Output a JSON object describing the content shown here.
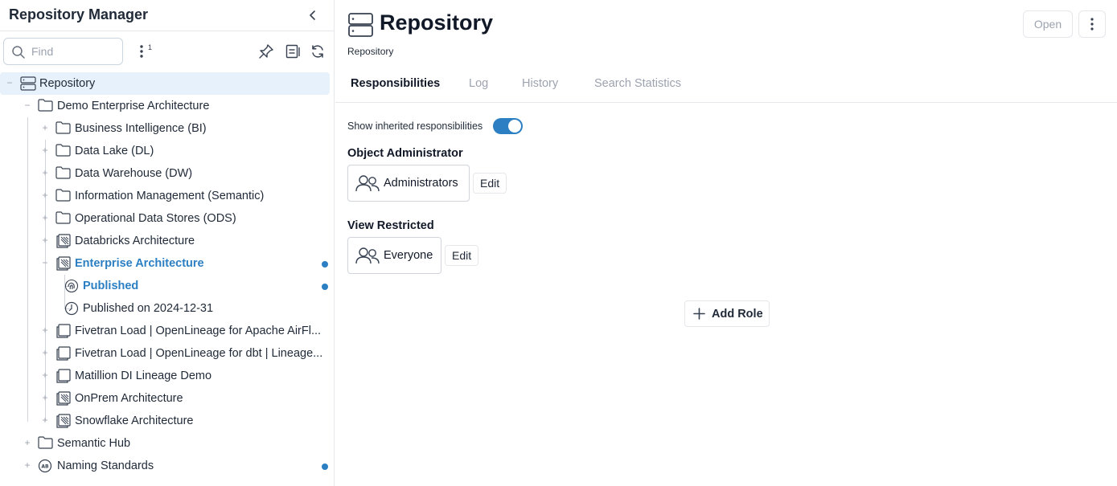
{
  "sidebar": {
    "title": "Repository Manager",
    "search_placeholder": "Find",
    "filter_badge": "1",
    "tree": [
      {
        "label": "Repository",
        "icon": "server-icon",
        "expander": "−",
        "selected": true
      },
      {
        "label": "Demo Enterprise Architecture",
        "icon": "folder-icon",
        "expander": "−"
      },
      {
        "label": "Business Intelligence (BI)",
        "icon": "folder-icon",
        "expander": "+"
      },
      {
        "label": "Data Lake (DL)",
        "icon": "folder-icon",
        "expander": "+"
      },
      {
        "label": "Data Warehouse (DW)",
        "icon": "folder-icon",
        "expander": "+"
      },
      {
        "label": "Information Management (Semantic)",
        "icon": "folder-icon",
        "expander": "+"
      },
      {
        "label": "Operational Data Stores (ODS)",
        "icon": "folder-icon",
        "expander": "+"
      },
      {
        "label": "Databricks Architecture",
        "icon": "stacked-model-icon",
        "expander": "+"
      },
      {
        "label": "Enterprise Architecture",
        "icon": "stacked-model-icon",
        "expander": "−",
        "active": true,
        "dot": true
      },
      {
        "label": "Published",
        "icon": "fingerprint-icon",
        "active": true,
        "dot": true
      },
      {
        "label": "Published on 2024-12-31",
        "icon": "clock-icon"
      },
      {
        "label": "Fivetran Load | OpenLineage for Apache AirFl...",
        "icon": "model-copy-icon",
        "expander": "+"
      },
      {
        "label": "Fivetran Load | OpenLineage for dbt | Lineage...",
        "icon": "model-copy-icon",
        "expander": "+"
      },
      {
        "label": "Matillion DI Lineage Demo",
        "icon": "model-copy-icon",
        "expander": "+"
      },
      {
        "label": "OnPrem Architecture",
        "icon": "stacked-model-icon",
        "expander": "+"
      },
      {
        "label": "Snowflake Architecture",
        "icon": "stacked-model-icon",
        "expander": "+"
      },
      {
        "label": "Semantic Hub",
        "icon": "folder-icon",
        "expander": "+"
      },
      {
        "label": "Naming Standards",
        "icon": "naming-standards-icon",
        "expander": "+",
        "dot": true
      }
    ]
  },
  "main": {
    "title": "Repository",
    "subtitle": "Repository",
    "open_label": "Open",
    "tabs": [
      "Responsibilities",
      "Log",
      "History",
      "Search Statistics"
    ],
    "active_tab": "Responsibilities",
    "inherited_label": "Show inherited responsibilities",
    "inherited_on": true,
    "roles": [
      {
        "title": "Object Administrator",
        "member": "Administrators",
        "edit_label": "Edit"
      },
      {
        "title": "View Restricted",
        "member": "Everyone",
        "edit_label": "Edit"
      }
    ],
    "add_role_label": "Add Role"
  },
  "colors": {
    "accent": "#2b7fc2",
    "selected_bg": "#e6f1fb",
    "border": "#e5e7eb"
  }
}
